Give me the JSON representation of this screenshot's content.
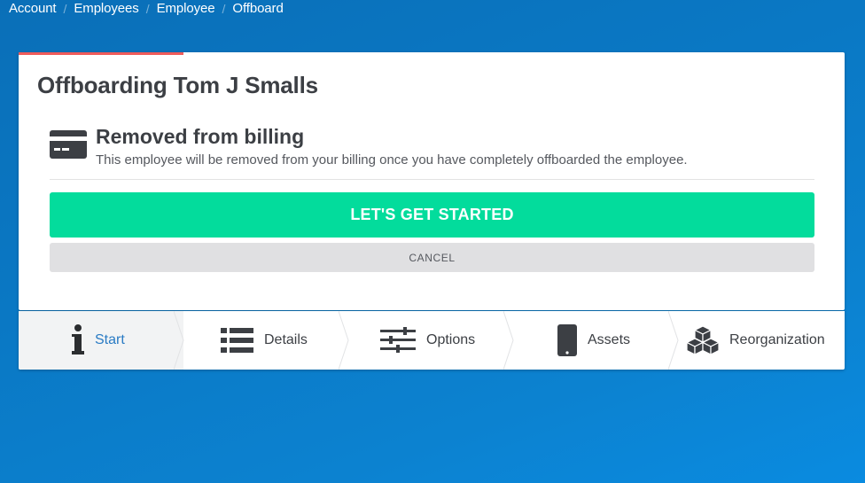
{
  "breadcrumb": {
    "items": [
      "Account",
      "Employees",
      "Employee",
      "Offboard"
    ],
    "separator": "/"
  },
  "card": {
    "title": "Offboarding Tom J Smalls",
    "notice": {
      "icon": "credit-card-icon",
      "title": "Removed from billing",
      "description": "This employee will be removed from your billing once you have completely offboarded the employee."
    },
    "primary_button": "LET'S GET STARTED",
    "cancel_button": "CANCEL"
  },
  "steps": [
    {
      "label": "Start",
      "icon": "info-icon",
      "active": true
    },
    {
      "label": "Details",
      "icon": "list-icon",
      "active": false
    },
    {
      "label": "Options",
      "icon": "sliders-icon",
      "active": false
    },
    {
      "label": "Assets",
      "icon": "phone-icon",
      "active": false
    },
    {
      "label": "Reorganization",
      "icon": "cubes-icon",
      "active": false
    }
  ],
  "colors": {
    "background": "#0a78c4",
    "accent_green": "#03dc9c",
    "progress_red": "#ef5b5b",
    "active_step_text": "#2a7bc4"
  }
}
